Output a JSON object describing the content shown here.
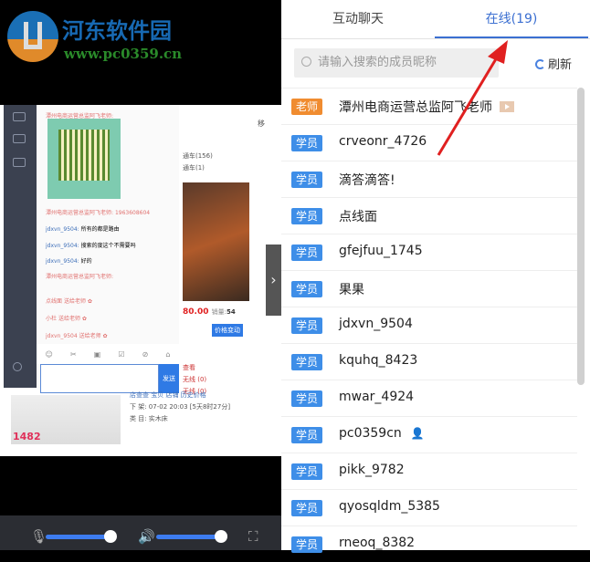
{
  "watermark": {
    "title": "河东软件园",
    "url": "www.pc0359.cn"
  },
  "chat": {
    "messages": [
      {
        "user": "潭州电商运营总监阿飞老师:",
        "text": ""
      },
      {
        "user": "潭州电商运营总监阿飞老师:",
        "text": "1963608604"
      },
      {
        "user": "jdxvn_9504:",
        "text": "所有的都是路由"
      },
      {
        "user": "jdxvn_9504:",
        "text": "搜索的度这个不需要吗"
      },
      {
        "user": "jdxvn_9504:",
        "text": "好的"
      },
      {
        "user": "潭州电商运营总监阿飞老师:",
        "text": ""
      },
      {
        "user": "点线面",
        "text": "送给老师"
      },
      {
        "user": "小杜",
        "text": "送给老师"
      },
      {
        "user": "jdxvn_9504",
        "text": "送给老师"
      }
    ],
    "send_label": "发送"
  },
  "product": {
    "price": "80.00",
    "sales_label": "销量:",
    "sales": "54",
    "price_change": "价格变动",
    "cart1": "通车(156)",
    "cart2": "通车(1)",
    "view": "查看",
    "wireless1": "无线 (0)",
    "wireless2": "无线 (0)",
    "links": "店查查 宝贝 店铺 历史价格",
    "offshelf": "下 架: 07-02 20:03 [5天8时27分]",
    "category": "类 目: 实木床",
    "side_price": "1482",
    "move": "移"
  },
  "tabs": [
    {
      "label": "互动聊天"
    },
    {
      "label": "在线(19)"
    }
  ],
  "search": {
    "placeholder": "请输入搜索的成员昵称"
  },
  "refresh_label": "刷新",
  "members": [
    {
      "role": "老师",
      "name": "潭州电商运营总监阿飞老师",
      "teacher": true
    },
    {
      "role": "学员",
      "name": "crveonr_4726"
    },
    {
      "role": "学员",
      "name": "滴答滴答!"
    },
    {
      "role": "学员",
      "name": "点线面"
    },
    {
      "role": "学员",
      "name": "gfejfuu_1745"
    },
    {
      "role": "学员",
      "name": "果果"
    },
    {
      "role": "学员",
      "name": "jdxvn_9504"
    },
    {
      "role": "学员",
      "name": "kquhq_8423"
    },
    {
      "role": "学员",
      "name": "mwar_4924"
    },
    {
      "role": "学员",
      "name": "pc0359cn",
      "self": true
    },
    {
      "role": "学员",
      "name": "pikk_9782"
    },
    {
      "role": "学员",
      "name": "qyosqldm_5385"
    },
    {
      "role": "学员",
      "name": "rneoq_8382"
    }
  ],
  "controls": {
    "mic_level": 0.85,
    "volume_level": 0.85
  },
  "colors": {
    "accent": "#3b6fd1",
    "teacher": "#f08c30",
    "student": "#3e8ee8"
  }
}
